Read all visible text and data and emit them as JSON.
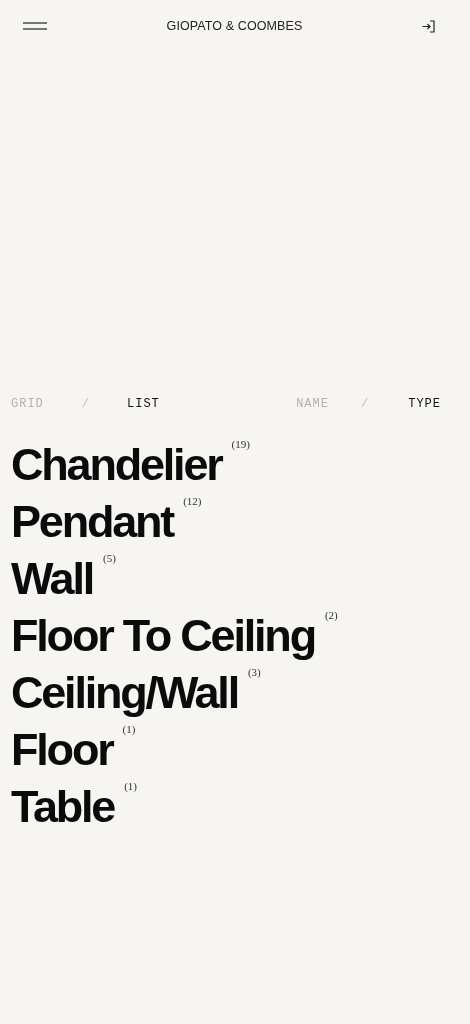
{
  "header": {
    "title": "GIOPATO & COOMBES"
  },
  "view_toggle": [
    {
      "label": "GRID",
      "selected": false
    },
    {
      "label": "LIST",
      "selected": true
    }
  ],
  "view_separator": "/",
  "sort_toggle": [
    {
      "label": "NAME",
      "selected": false
    },
    {
      "label": "TYPE",
      "selected": true
    }
  ],
  "sort_separator": "/",
  "categories": [
    {
      "name": "Chandelier",
      "count": "(19)"
    },
    {
      "name": "Pendant",
      "count": "(12)"
    },
    {
      "name": "Wall",
      "count": "(5)"
    },
    {
      "name": "Floor To Ceiling",
      "count": "(2)"
    },
    {
      "name": "Ceiling/Wall",
      "count": "(3)"
    },
    {
      "name": "Floor",
      "count": "(1)"
    },
    {
      "name": "Table",
      "count": "(1)"
    }
  ]
}
